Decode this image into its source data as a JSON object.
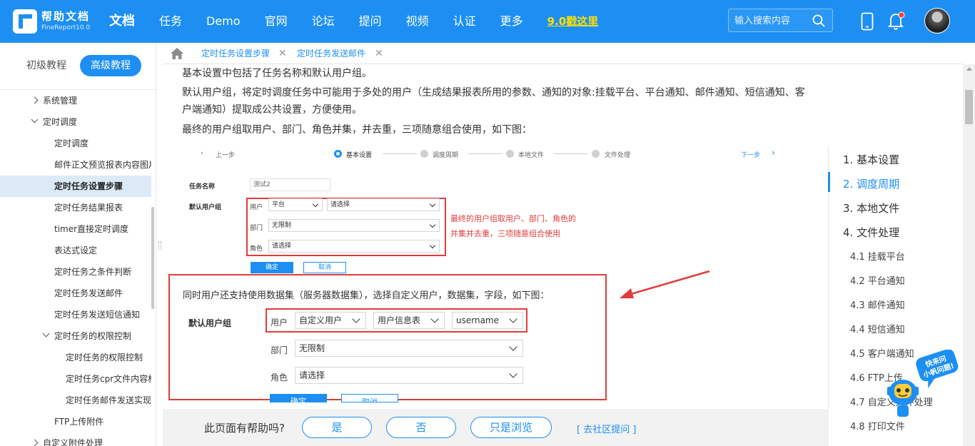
{
  "header": {
    "logo_title": "帮助文档",
    "logo_sub": "FineReport10.0",
    "nav": [
      "文档",
      "任务",
      "Demo",
      "官网",
      "论坛",
      "提问",
      "视频",
      "认证",
      "更多"
    ],
    "nav_active": "文档",
    "promo": "9.0戳这里",
    "search_placeholder": "输入搜索内容",
    "brand_color": "#1d8ff3",
    "promo_color": "#ffe100"
  },
  "sidebar": {
    "tab_basic": "初级教程",
    "tab_advanced": "高级教程",
    "items": [
      {
        "label": "系统管理",
        "level": 1,
        "arrow": "right"
      },
      {
        "label": "定时调度",
        "level": 1,
        "arrow": "down"
      },
      {
        "label": "定时调度",
        "level": 2
      },
      {
        "label": "邮件正文预览报表内容图片",
        "level": 2
      },
      {
        "label": "定时任务设置步骤",
        "level": 2,
        "active": true
      },
      {
        "label": "定时任务结果报表",
        "level": 2
      },
      {
        "label": "timer直接定时调度",
        "level": 2
      },
      {
        "label": "表达式设定",
        "level": 2
      },
      {
        "label": "定时任务之条件判断",
        "level": 2
      },
      {
        "label": "定时任务发送邮件",
        "level": 2
      },
      {
        "label": "定时任务发送短信通知",
        "level": 2
      },
      {
        "label": "定时任务的权限控制",
        "level": 2,
        "arrow": "down"
      },
      {
        "label": "定时任务的权限控制",
        "level": 3
      },
      {
        "label": "定时任务cpr文件内容权限",
        "level": 3
      },
      {
        "label": "定时任务邮件发送实现",
        "level": 3
      },
      {
        "label": "FTP上传附件",
        "level": 2
      },
      {
        "label": "自定义附件处理",
        "level": 1,
        "arrow": "right"
      }
    ]
  },
  "tabs": {
    "items": [
      {
        "label": "定时任务设置步骤",
        "closable": true
      },
      {
        "label": "定时任务发送邮件",
        "closable": true
      }
    ]
  },
  "content": {
    "p1": "基本设置中包括了任务名称和默认用户组。",
    "p2a": "默认用户组，将定时调度任务中可能用于多处的用户（生成结果报表所用的参数、通知的对象:挂载平台、平台通知、邮件通知、短信通知、客",
    "p2b": "户端通知）提取成公共设置，方便使用。",
    "p3": "最终的用户组取用户、部门、角色并集，并去重，三项随意组合使用，如下图：",
    "mock": {
      "prev": "上一步",
      "next": "下一步",
      "steps": [
        "基本设置",
        "调度周期",
        "本地文件",
        "文件处理"
      ],
      "task_name_label": "任务名称",
      "task_name_value": "测试2",
      "user_group_label": "默认用户组",
      "user_label": "用户",
      "user_select1": "平台",
      "user_select2": "请选择",
      "dept_label": "部门",
      "dept_value": "无限制",
      "role_label": "角色",
      "role_value": "请选择",
      "note_line1": "最终的用户组取用户、部门、角色的",
      "note_line2": "并集并去重，三项随意组合使用",
      "ok": "确定",
      "cancel": "取消",
      "ds_text": "同时用户还支持使用数据集（服务器数据集），选择自定义用户，数据集，字段，如下图：",
      "ds_group_label": "默认用户组",
      "ds_user_label": "用户",
      "ds_user_select1": "自定义用户",
      "ds_user_select2": "用户信息表",
      "ds_user_select3": "username",
      "ds_dept_label": "部门",
      "ds_dept_value": "无限制",
      "ds_role_label": "角色",
      "ds_role_value": "请选择",
      "ds_ok": "确定",
      "ds_cancel": "取消"
    }
  },
  "toc": {
    "items": [
      {
        "label": "1. 基本设置",
        "level": 1
      },
      {
        "label": "2. 调度周期",
        "level": 1,
        "active": true
      },
      {
        "label": "3. 本地文件",
        "level": 1
      },
      {
        "label": "4. 文件处理",
        "level": 1
      },
      {
        "label": "4.1 挂载平台",
        "level": 2
      },
      {
        "label": "4.2 平台通知",
        "level": 2
      },
      {
        "label": "4.3 邮件通知",
        "level": 2
      },
      {
        "label": "4.4 短信通知",
        "level": 2
      },
      {
        "label": "4.5 客户端通知",
        "level": 2
      },
      {
        "label": "4.6 FTP上传",
        "level": 2
      },
      {
        "label": "4.7 自定义文件处理",
        "level": 2
      },
      {
        "label": "4.8 打印文件",
        "level": 2
      }
    ]
  },
  "feedback": {
    "question": "此页面有帮助吗?",
    "yes": "是",
    "no": "否",
    "browse": "只是浏览",
    "community": "[ 去社区提问 ]"
  },
  "mascot": {
    "bubble1": "快来问",
    "bubble2": "小帆问题!"
  }
}
